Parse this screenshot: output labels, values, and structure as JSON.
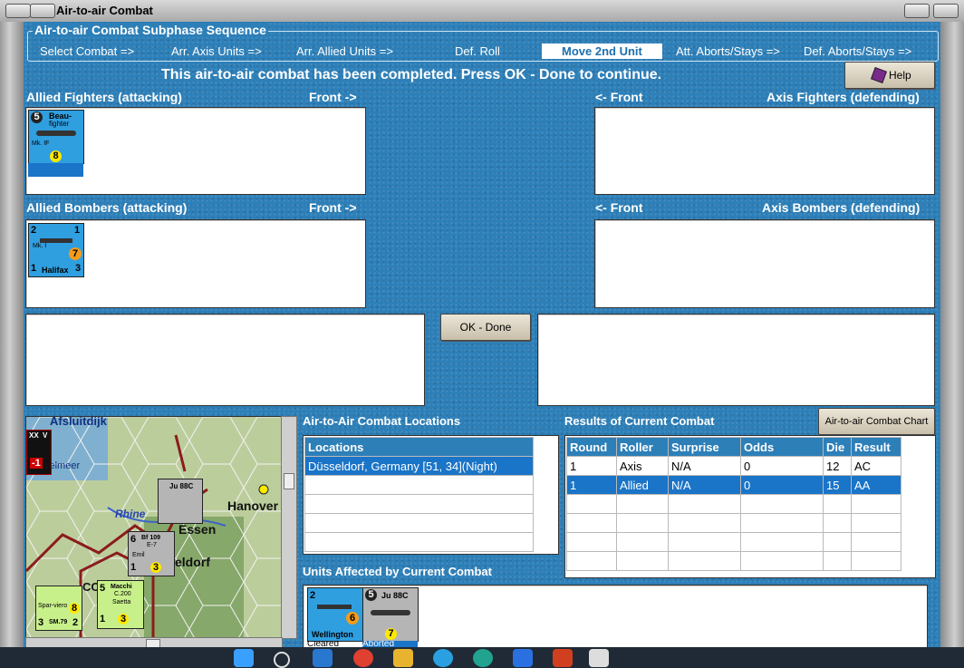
{
  "window": {
    "title": "Air-to-air Combat"
  },
  "sequence": {
    "title": "Air-to-air Combat Subphase Sequence",
    "steps": [
      "Select Combat =>",
      "Arr. Axis Units =>",
      "Arr. Allied Units =>",
      "Def. Roll",
      "Move 2nd Unit",
      "Att. Aborts/Stays =>",
      "Def. Aborts/Stays =>"
    ],
    "active_step": "Move 2nd Unit"
  },
  "message": "This air-to-air combat has been completed.  Press OK - Done to continue.",
  "help_button": "Help",
  "panels": {
    "allied_fighters": {
      "title": "Allied Fighters (attacking)",
      "front": "Front ->"
    },
    "axis_fighters": {
      "title": "Axis Fighters (defending)",
      "front": "<- Front"
    },
    "allied_bombers": {
      "title": "Allied Bombers (attacking)",
      "front": "Front ->"
    },
    "axis_bombers": {
      "title": "Axis Bombers (defending)",
      "front": "<- Front"
    }
  },
  "units": {
    "beaufighter": {
      "name1": "Beau-",
      "name2": "fighter",
      "model": "Mk. IF",
      "top": "5",
      "rating": "8"
    },
    "halifax": {
      "name": "Halifax",
      "model": "Mk. I",
      "tl": "2",
      "tr": "1",
      "bl": "1",
      "br": "3",
      "rating": "7"
    },
    "wellington": {
      "name": "Wellington",
      "tl": "2",
      "rating": "6",
      "status": "Cleared"
    },
    "ju88c": {
      "name": "Ju 88C",
      "top": "5",
      "rating": "7",
      "status": "Aborted"
    }
  },
  "ok_button": "OK - Done",
  "chart_button": "Air-to-air Combat Chart",
  "locations": {
    "heading": "Air-to-Air Combat Locations",
    "column": "Locations",
    "rows": [
      "Düsseldorf, Germany [51, 34](Night)"
    ]
  },
  "results": {
    "heading": "Results of Current Combat",
    "columns": [
      "Round",
      "Roller",
      "Surprise",
      "Odds",
      "Die",
      "Result"
    ],
    "rows": [
      [
        "1",
        "Axis",
        "N/A",
        "0",
        "12",
        "AC"
      ],
      [
        "1",
        "Allied",
        "N/A",
        "0",
        "15",
        "AA"
      ]
    ]
  },
  "affected": {
    "heading": "Units Affected by Current Combat"
  },
  "map": {
    "labels": [
      "Afsluitdijk",
      "selmeer",
      "Rhine",
      "Essen",
      "Hanover",
      "eldorf",
      "CO"
    ],
    "units": {
      "ju88c": "Ju 88C",
      "bf109": {
        "name": "Bf 109",
        "model": "E-7",
        "sub": "Emil",
        "top": "6",
        "tl": "1",
        "rating": "3"
      },
      "macchi": {
        "name": "Macchi",
        "model": "C.200",
        "sub": "Saetta",
        "top": "5",
        "bl": "1",
        "rating": "3"
      },
      "sm79": {
        "name": "Spar-viero",
        "model": "SM.79",
        "bl": "3",
        "rating": "8",
        "br": "2"
      },
      "corner": {
        "a": "XX",
        "b": "V",
        "c": "-1"
      }
    }
  },
  "colors": {
    "background": "#2d7fb8",
    "selection": "#1a74c7",
    "counter_allied": "#2f9fe0",
    "counter_axis": "#b5b5b5",
    "counter_italian": "#c8f08a"
  }
}
